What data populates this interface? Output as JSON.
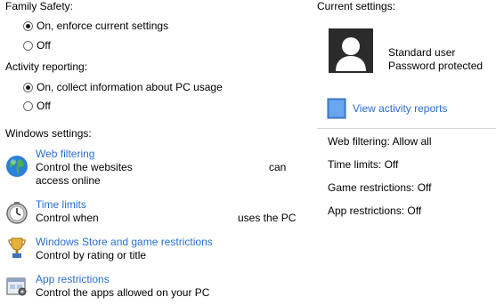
{
  "family_safety": {
    "title": "Family Safety:",
    "options": [
      "On, enforce current settings",
      "Off"
    ],
    "selected_index": 0
  },
  "activity_reporting": {
    "title": "Activity reporting:",
    "options": [
      "On, collect information about PC usage",
      "Off"
    ],
    "selected_index": 0
  },
  "windows_settings": {
    "title": "Windows settings:",
    "items": [
      {
        "title": "Web filtering",
        "desc_part1": "Control the websites",
        "desc_part2": "can",
        "desc_line2": "access online",
        "icon": "globe-icon"
      },
      {
        "title": "Time limits",
        "desc_part1": "Control when",
        "desc_part2": "uses the PC",
        "icon": "clock-icon"
      },
      {
        "title": "Windows Store and game restrictions",
        "desc_part1": "Control by rating or title",
        "icon": "trophy-icon"
      },
      {
        "title": "App restrictions",
        "desc_part1": "Control the apps allowed on your PC",
        "icon": "app-window-icon"
      }
    ]
  },
  "current_settings": {
    "title": "Current settings:",
    "account_type": "Standard user",
    "password_status": "Password protected",
    "view_reports_label": "View activity reports",
    "summary": [
      {
        "label": "Web filtering:",
        "value": "Allow all"
      },
      {
        "label": "Time limits:",
        "value": "Off"
      },
      {
        "label": "Game restrictions:",
        "value": "Off"
      },
      {
        "label": "App restrictions:",
        "value": "Off"
      }
    ]
  },
  "colors": {
    "link": "#2a6ed1",
    "avatar_bg": "#2b2b2b",
    "divider": "#d7d7d7"
  }
}
